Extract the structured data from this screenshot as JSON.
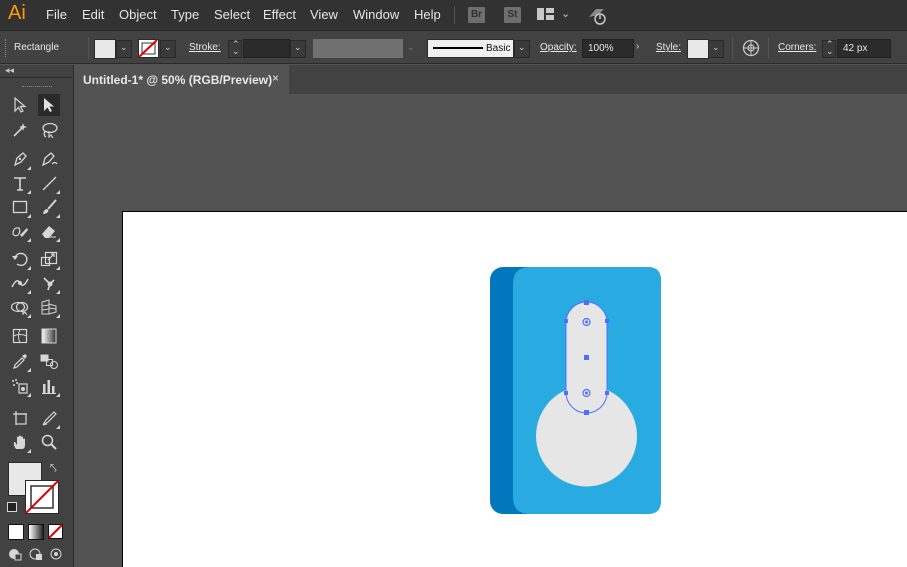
{
  "app": {
    "logo": "Ai"
  },
  "menu": {
    "items": [
      "File",
      "Edit",
      "Object",
      "Type",
      "Select",
      "Effect",
      "View",
      "Window",
      "Help"
    ]
  },
  "menubar_buttons": {
    "bridge": "Br",
    "stock": "St"
  },
  "control_bar": {
    "tool_name": "Rectangle",
    "stroke_label": "Stroke:",
    "stroke_value": "",
    "brush_label": "Basic",
    "opacity_label": "Opacity:",
    "opacity_value": "100%",
    "style_label": "Style:",
    "corners_label": "Corners:",
    "corners_value": "42 px"
  },
  "document_tab": {
    "title": "Untitled-1* @ 50% (RGB/Preview)",
    "close": "×"
  },
  "toolbar": {
    "collapse_glyph": "◂◂",
    "tools": [
      [
        "selection-tool",
        "direct-selection-tool"
      ],
      [
        "magic-wand-tool",
        "lasso-tool"
      ],
      [
        "pen-tool",
        "curvature-tool"
      ],
      [
        "type-tool",
        "line-segment-tool"
      ],
      [
        "rectangle-tool",
        "paintbrush-tool"
      ],
      [
        "shaper-tool",
        "eraser-tool"
      ],
      [
        "rotate-tool",
        "scale-tool"
      ],
      [
        "width-tool",
        "puppet-warp-tool"
      ],
      [
        "shape-builder-tool",
        "perspective-grid-tool"
      ],
      [
        "mesh-tool",
        "gradient-tool"
      ],
      [
        "eyedropper-tool",
        "blend-tool"
      ],
      [
        "symbol-sprayer-tool",
        "column-graph-tool"
      ],
      [
        "artboard-tool",
        "slice-tool"
      ],
      [
        "hand-tool",
        "zoom-tool"
      ]
    ],
    "fill_color": "#e8e8e8",
    "stroke_color": "none"
  },
  "colors": {
    "illustration_dark_blue": "#0277bd",
    "illustration_light_blue": "#29abe2",
    "illustration_gray": "#e6e6e6",
    "selection": "#4c6fff"
  }
}
